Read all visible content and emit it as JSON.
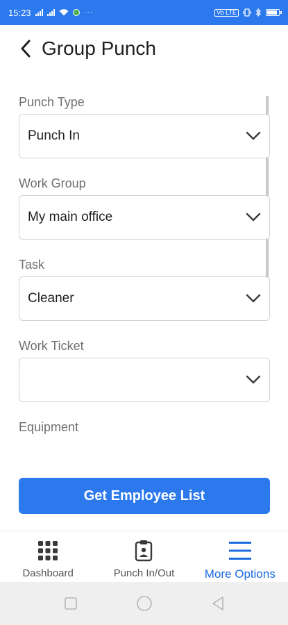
{
  "status_bar": {
    "time": "15:23",
    "dots": "···",
    "volte": "Vo LTE"
  },
  "header": {
    "title": "Group Punch"
  },
  "form": {
    "punch_type": {
      "label": "Punch Type",
      "value": "Punch In"
    },
    "work_group": {
      "label": "Work Group",
      "value": "My main office"
    },
    "task": {
      "label": "Task",
      "value": "Cleaner"
    },
    "work_ticket": {
      "label": "Work Ticket",
      "value": ""
    },
    "equipment": {
      "label": "Equipment"
    }
  },
  "actions": {
    "get_employee_list": "Get Employee List"
  },
  "bottom_nav": {
    "items": [
      {
        "label": "Dashboard",
        "icon": "grid-icon"
      },
      {
        "label": "Punch In/Out",
        "icon": "clipboard-badge-icon"
      },
      {
        "label": "More Options",
        "icon": "menu-icon",
        "active": true
      }
    ]
  },
  "colors": {
    "accent": "#2b79ec",
    "active_nav": "#1a6be0"
  }
}
